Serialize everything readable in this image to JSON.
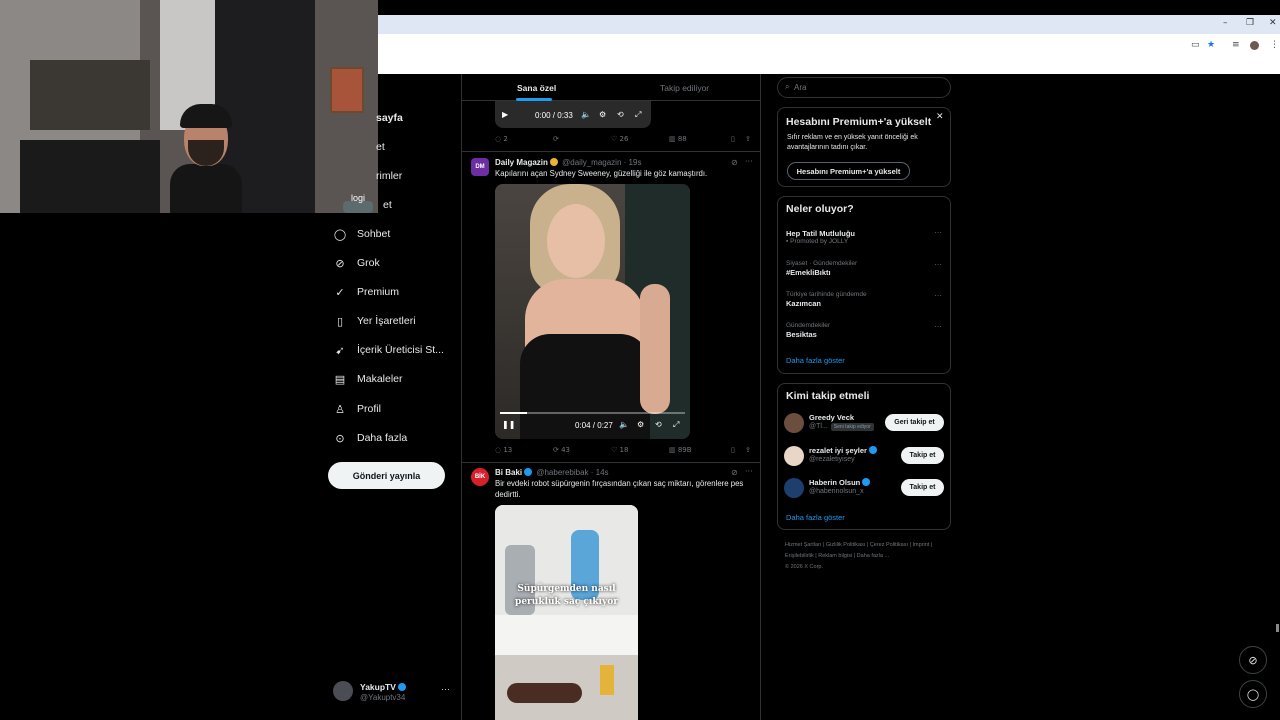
{
  "webcam": {
    "overlay_text": "logi"
  },
  "nav": {
    "partials": [
      {
        "text": "sayfa"
      },
      {
        "text": "et"
      },
      {
        "text": "rimler"
      },
      {
        "text": "et"
      }
    ],
    "items": [
      {
        "label": "Sohbet",
        "icon": "chat-icon"
      },
      {
        "label": "Grok",
        "icon": "grok-icon"
      },
      {
        "label": "Premium",
        "icon": "premium-icon"
      },
      {
        "label": "Yer İşaretleri",
        "icon": "bookmark-icon"
      },
      {
        "label": "İçerik Üreticisi St...",
        "icon": "creator-studio-icon"
      },
      {
        "label": "Makaleler",
        "icon": "articles-icon"
      },
      {
        "label": "Profil",
        "icon": "profile-icon"
      },
      {
        "label": "Daha fazla",
        "icon": "more-icon"
      }
    ],
    "post_button": "Gönderi yayınla"
  },
  "account": {
    "name": "YakupTV",
    "handle": "@Yakuptv34"
  },
  "feed": {
    "tabs": [
      {
        "label": "Sana özel",
        "active": true
      },
      {
        "label": "Takip ediliyor",
        "active": false
      }
    ],
    "post0": {
      "video_time": "0:00 / 0:33",
      "replies": "2",
      "likes": "26",
      "views": "88"
    },
    "post1": {
      "avatar_text": "DM",
      "name": "Daily Magazin",
      "handle": "@daily_magazin",
      "time": "19s",
      "text": "Kapılarını açan Sydney Sweeney, güzelliği ile göz kamaştırdı.",
      "video_time": "0:04 / 0:27",
      "progress": 0.148,
      "replies": "13",
      "reposts": "43",
      "likes": "18",
      "views": "89B"
    },
    "post2": {
      "avatar_text": "BİK",
      "name": "Bi Baki",
      "handle": "@haberebibak",
      "time": "14s",
      "text": "Bir evdeki robot süpürgenin fırçasından çıkan saç miktarı, görenlere pes dedirtti.",
      "media_caption": "Süpürgemden nasıl peruklük saç çıkıyor"
    }
  },
  "sidebar": {
    "search_placeholder": "Ara",
    "premium": {
      "title": "Hesabını Premium+'a yükselt",
      "description": "Sıfır reklam ve en yüksek yanıt önceliği ek avantajlarının tadını çıkar.",
      "button": "Hesabını Premium+'a yükselt"
    },
    "trends": {
      "title": "Neler oluyor?",
      "items": [
        {
          "meta": "",
          "topic": "Hep Tatil Mutluluğu",
          "sub": "Promoted by JOLLY"
        },
        {
          "meta": "Siyaset · Gündemdekiler",
          "topic": "#EmekliBıktı",
          "sub": ""
        },
        {
          "meta": "Türkiye tarihinde gündemde",
          "topic": "Kazımcan",
          "sub": ""
        },
        {
          "meta": "Gündemdekiler",
          "topic": "Besiktas",
          "sub": ""
        }
      ],
      "show_more": "Daha fazla göster"
    },
    "who_to_follow": {
      "title": "Kimi takip etmeli",
      "items": [
        {
          "name": "Greedy Veck",
          "handle": "@Tl...",
          "badge": "Seni takip ediyor",
          "button": "Geri takip et",
          "avatar_color": "#6b4e3d",
          "verified": false
        },
        {
          "name": "rezalet iyi şeyler",
          "handle": "@rezaletiyisey",
          "badge": "",
          "button": "Takip et",
          "avatar_color": "#e8d7c8",
          "verified": true
        },
        {
          "name": "Haberin Olsun",
          "handle": "@haberinolsun_x",
          "badge": "",
          "button": "Takip et",
          "avatar_color": "#1c3f6e",
          "verified": true
        }
      ],
      "show_more": "Daha fazla göster"
    },
    "footer": {
      "links": [
        "Hizmet Şartları",
        "Gizlilik Politikası",
        "Çerez Politikası",
        "Imprint",
        "Erişilebilirlik",
        "Reklam bilgisi",
        "Daha fazla ..."
      ],
      "copyright": "© 2026 X Corp."
    }
  }
}
